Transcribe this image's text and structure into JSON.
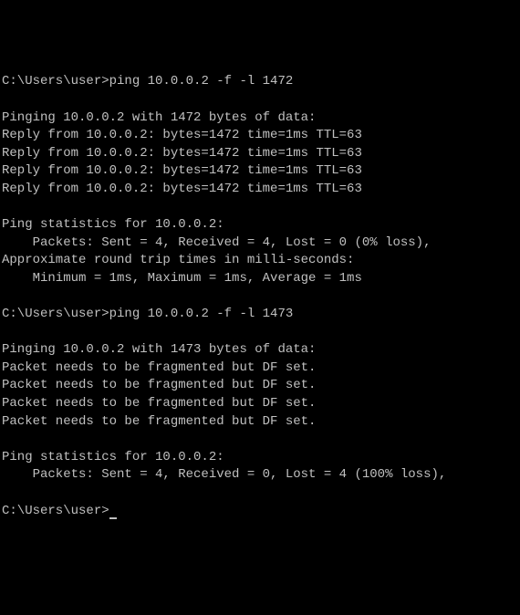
{
  "terminal": {
    "prompt1": {
      "path": "C:\\Users\\user>",
      "command": "ping 10.0.0.2 -f -l 1472"
    },
    "session1": {
      "header": "Pinging 10.0.0.2 with 1472 bytes of data:",
      "replies": [
        "Reply from 10.0.0.2: bytes=1472 time=1ms TTL=63",
        "Reply from 10.0.0.2: bytes=1472 time=1ms TTL=63",
        "Reply from 10.0.0.2: bytes=1472 time=1ms TTL=63",
        "Reply from 10.0.0.2: bytes=1472 time=1ms TTL=63"
      ],
      "stats_header": "Ping statistics for 10.0.0.2:",
      "packets": "    Packets: Sent = 4, Received = 4, Lost = 0 (0% loss),",
      "rtt_header": "Approximate round trip times in milli-seconds:",
      "rtt_values": "    Minimum = 1ms, Maximum = 1ms, Average = 1ms"
    },
    "prompt2": {
      "path": "C:\\Users\\user>",
      "command": "ping 10.0.0.2 -f -l 1473"
    },
    "session2": {
      "header": "Pinging 10.0.0.2 with 1473 bytes of data:",
      "replies": [
        "Packet needs to be fragmented but DF set.",
        "Packet needs to be fragmented but DF set.",
        "Packet needs to be fragmented but DF set.",
        "Packet needs to be fragmented but DF set."
      ],
      "stats_header": "Ping statistics for 10.0.0.2:",
      "packets": "    Packets: Sent = 4, Received = 0, Lost = 4 (100% loss),"
    },
    "prompt3": {
      "path": "C:\\Users\\user>"
    }
  }
}
